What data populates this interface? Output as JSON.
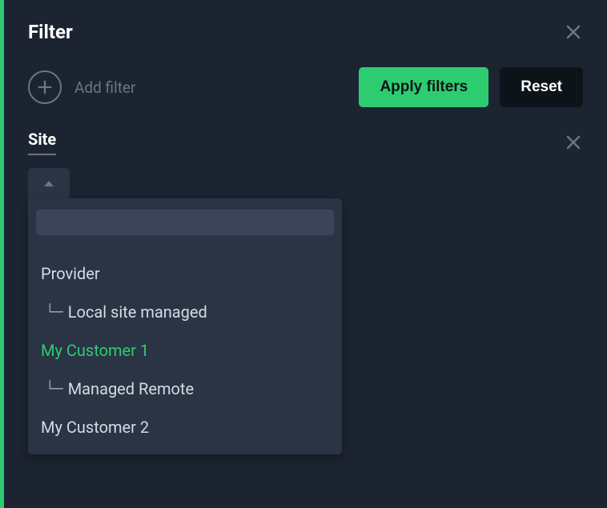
{
  "header": {
    "title": "Filter"
  },
  "actions": {
    "add_filter_label": "Add filter",
    "apply_label": "Apply filters",
    "reset_label": "Reset"
  },
  "filter": {
    "label": "Site",
    "search_value": "",
    "items": [
      {
        "label": "Provider",
        "level": 0,
        "selected": false
      },
      {
        "label": "Local site managed",
        "level": 1,
        "selected": false
      },
      {
        "label": "My Customer 1",
        "level": 0,
        "selected": true
      },
      {
        "label": "Managed Remote",
        "level": 1,
        "selected": false
      },
      {
        "label": "My Customer 2",
        "level": 0,
        "selected": false
      }
    ]
  },
  "colors": {
    "accent": "#2ecc71",
    "bg": "#1c2431",
    "panel": "#2a3445"
  }
}
